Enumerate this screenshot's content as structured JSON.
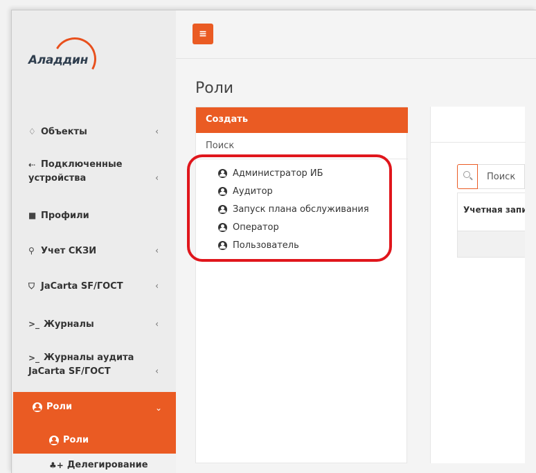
{
  "brand": {
    "logo_text": "Аладдин",
    "accent": "#ea5b23"
  },
  "sidebar": {
    "items": [
      {
        "icon": "diamond-icon",
        "glyph": "♢",
        "label": "Объекты",
        "chevron": "‹"
      },
      {
        "icon": "usb-icon",
        "glyph": "⇠",
        "label_line1": "Подключенные",
        "label_line2": "устройства",
        "chevron": "‹"
      },
      {
        "icon": "folder-icon",
        "glyph": "■",
        "label": "Профили"
      },
      {
        "icon": "key-icon",
        "glyph": "⚲",
        "label": "Учет СКЗИ",
        "chevron": "‹"
      },
      {
        "icon": "shield-icon",
        "glyph": "⛉",
        "label": "JaCarta SF/ГОСТ",
        "chevron": "‹"
      },
      {
        "icon": "terminal-icon",
        "glyph": ">_",
        "label": "Журналы",
        "chevron": "‹"
      },
      {
        "icon": "terminal-icon",
        "glyph": ">_",
        "label_line1": "Журналы аудита",
        "label_line2": "JaCarta SF/ГОСТ",
        "chevron": "‹"
      }
    ],
    "active": {
      "label": "Роли",
      "chevron": "⌄",
      "sub_label": "Роли"
    },
    "delegation": {
      "label": "Делегирование",
      "glyph": "♣+"
    }
  },
  "topbar": {
    "menu_glyph": "≡"
  },
  "page": {
    "title": "Роли"
  },
  "roles_panel": {
    "create_label": "Создать",
    "search_label": "Поиск",
    "roles": [
      "Администратор ИБ",
      "Аудитор",
      "Запуск плана обслуживания",
      "Оператор",
      "Пользователь"
    ]
  },
  "right_panel": {
    "search_placeholder": "Поиск",
    "column_header": "Учетная запись"
  },
  "colors": {
    "accent": "#ea5b23",
    "highlight": "#e0161c"
  }
}
